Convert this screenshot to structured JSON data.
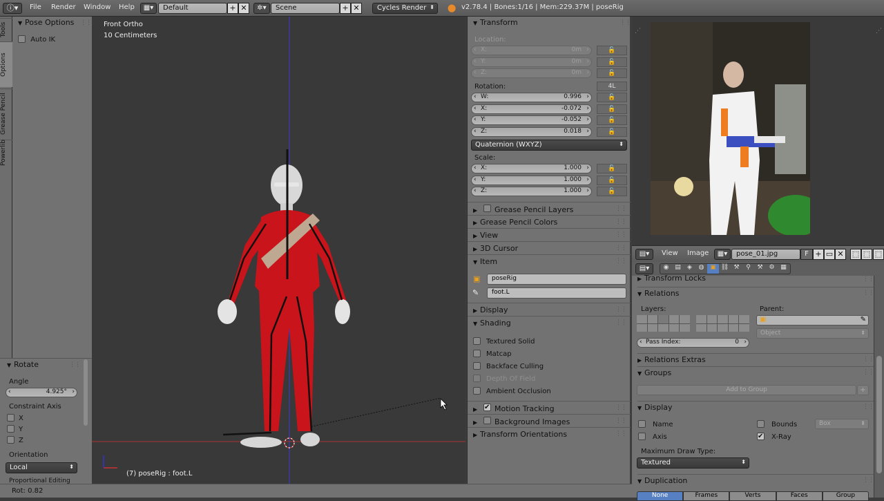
{
  "topbar": {
    "menus": [
      "File",
      "Render",
      "Window",
      "Help"
    ],
    "layout": "Default",
    "scene": "Scene",
    "engine": "Cycles Render",
    "stats": "v2.78.4 | Bones:1/16 | Mem:229.37M | poseRig"
  },
  "left_tabs": [
    "Tools",
    "Options",
    "Grease Pencil",
    "Powerlib"
  ],
  "tool_panel": {
    "pose_options_title": "Pose Options",
    "auto_ik": "Auto IK",
    "rotate_title": "Rotate",
    "angle_label": "Angle",
    "angle_value": "4.925°",
    "constraint_axis": "Constraint Axis",
    "axes": [
      "X",
      "Y",
      "Z"
    ],
    "orientation_label": "Orientation",
    "orientation_value": "Local",
    "proportional": "Proportional Editing"
  },
  "viewport": {
    "view_name": "Front Ortho",
    "scale": "10 Centimeters",
    "object_info": "(7) poseRig : foot.L"
  },
  "transform": {
    "title": "Transform",
    "location_label": "Location:",
    "location": [
      {
        "axis": "X:",
        "value": "0m"
      },
      {
        "axis": "Y:",
        "value": "0m"
      },
      {
        "axis": "Z:",
        "value": "0m"
      }
    ],
    "rotation_label": "Rotation:",
    "rotation_lock": "4L",
    "rotation": [
      {
        "axis": "W:",
        "value": "0.996"
      },
      {
        "axis": "X:",
        "value": "-0.072"
      },
      {
        "axis": "Y:",
        "value": "-0.052"
      },
      {
        "axis": "Z:",
        "value": "0.018"
      }
    ],
    "rotation_mode": "Quaternion (WXYZ)",
    "scale_label": "Scale:",
    "scale": [
      {
        "axis": "X:",
        "value": "1.000"
      },
      {
        "axis": "Y:",
        "value": "1.000"
      },
      {
        "axis": "Z:",
        "value": "1.000"
      }
    ]
  },
  "panels": {
    "grease_pencil_layers": "Grease Pencil Layers",
    "grease_pencil_colors": "Grease Pencil Colors",
    "view": "View",
    "cursor": "3D Cursor",
    "item": "Item",
    "item_object": "poseRig",
    "item_bone": "foot.L",
    "display": "Display",
    "shading": "Shading",
    "textured_solid": "Textured Solid",
    "matcap": "Matcap",
    "backface_culling": "Backface Culling",
    "depth_of_field": "Depth Of Field",
    "ambient_occlusion": "Ambient Occlusion",
    "motion_tracking": "Motion Tracking",
    "background_images": "Background Images",
    "transform_orientations": "Transform Orientations"
  },
  "image_editor": {
    "menus": [
      "View",
      "Image"
    ],
    "image_name": "pose_01.jpg",
    "f_label": "F"
  },
  "object_props": {
    "transform_locks": "Transform Locks",
    "relations": "Relations",
    "layers_label": "Layers:",
    "parent_label": "Parent:",
    "parent_type": "Object",
    "pass_index_label": "Pass Index:",
    "pass_index_value": "0",
    "relations_extras": "Relations Extras",
    "groups": "Groups",
    "add_to_group": "Add to Group",
    "display": "Display",
    "name": "Name",
    "bounds": "Bounds",
    "bounds_type": "Box",
    "axis": "Axis",
    "xray": "X-Ray",
    "max_draw_type_label": "Maximum Draw Type:",
    "max_draw_type": "Textured",
    "duplication": "Duplication",
    "dup_tabs": [
      "None",
      "Frames",
      "Verts",
      "Faces",
      "Group"
    ]
  },
  "status": {
    "text": "Rot: 0.82"
  },
  "colors": {
    "suit": "#c8141a",
    "viewport_bg": "#393939",
    "panel_bg": "#727272",
    "accent_blue": "#5680c2"
  }
}
